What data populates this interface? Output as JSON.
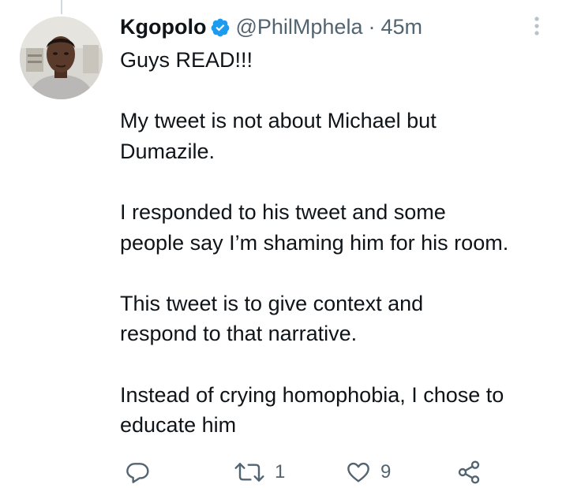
{
  "tweet": {
    "display_name": "Kgopolo",
    "handle": "@PhilMphela",
    "separator": "·",
    "time": "45m",
    "paragraphs": [
      "Guys READ!!!",
      "My tweet is not about Michael but\nDumazile.",
      "I responded to his tweet and some\npeople say I’m shaming him for his room.",
      "This tweet is to give context and\nrespond to that narrative.",
      "Instead of crying homophobia, I chose to\neducate him"
    ]
  },
  "actions": {
    "reply_icon": "reply-icon",
    "retweet_icon": "retweet-icon",
    "retweet_count": "1",
    "like_icon": "heart-icon",
    "like_count": "9",
    "share_icon": "share-icon"
  },
  "colors": {
    "text_primary": "#0f1419",
    "text_secondary": "#536471",
    "verified_blue": "#1d9bf0",
    "thread_line": "#cfd9de"
  }
}
